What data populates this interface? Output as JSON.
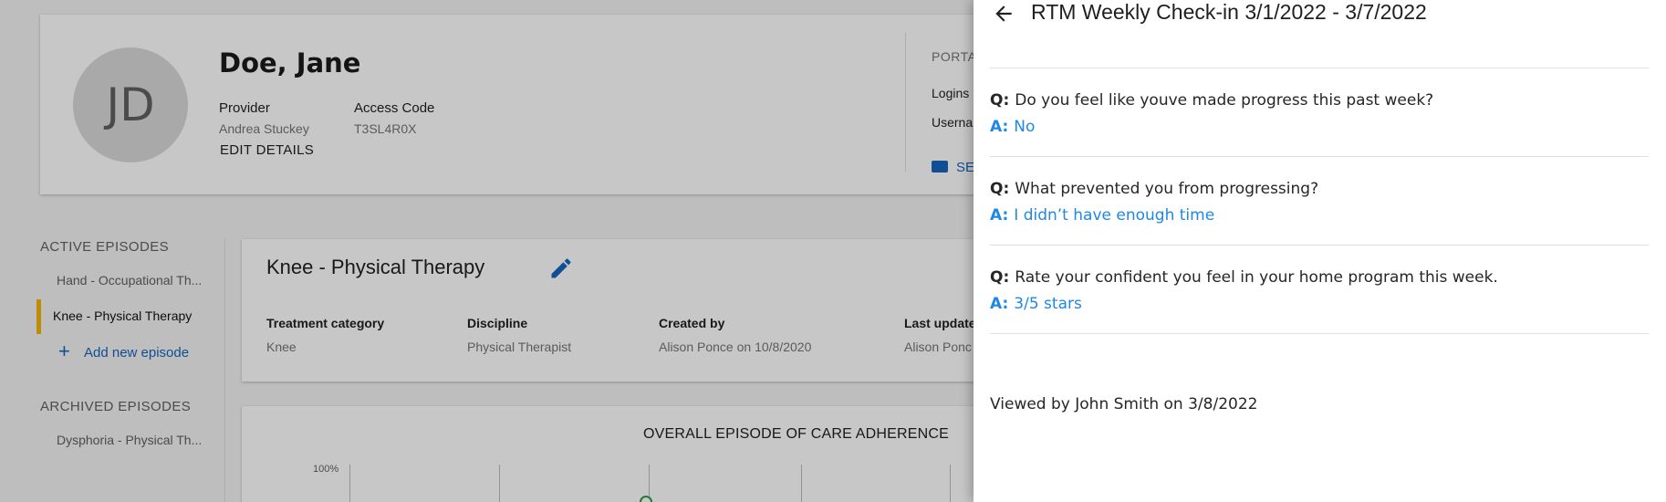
{
  "patient": {
    "initials": "JD",
    "name": "Doe, Jane",
    "provider_label": "Provider",
    "provider_value": "Andrea Stuckey",
    "access_code_label": "Access Code",
    "access_code_value": "T3SL4R0X",
    "edit_label": "EDIT DETAILS"
  },
  "portal": {
    "title": "PORTA",
    "logins": "Logins",
    "username": "Userna",
    "send_label": "SE"
  },
  "sidebar": {
    "active_heading": "ACTIVE EPISODES",
    "active_items": [
      {
        "label": "Hand  - Occupational Th..."
      },
      {
        "label": "Knee - Physical Therapy"
      }
    ],
    "add_label": "Add new episode",
    "archived_heading": "ARCHIVED EPISODES",
    "archived_items": [
      {
        "label": "Dysphoria - Physical Th..."
      }
    ]
  },
  "episode": {
    "title": "Knee - Physical Therapy",
    "columns": [
      {
        "label": "Treatment category",
        "value": "Knee"
      },
      {
        "label": "Discipline",
        "value": "Physical Therapist"
      },
      {
        "label": "Created by",
        "value": "Alison Ponce on 10/8/2020"
      },
      {
        "label": "Last update",
        "value": "Alison Ponc"
      }
    ]
  },
  "adherence": {
    "title": "OVERALL EPISODE OF CARE ADHERENCE",
    "y_tick": "100%"
  },
  "drawer": {
    "title": "RTM Weekly Check-in 3/1/2022 - 3/7/2022",
    "q_prefix": "Q:",
    "a_prefix": "A:",
    "qa": [
      {
        "question": "Do you feel like youve made progress this past week?",
        "answer": "No"
      },
      {
        "question": "What prevented you from progressing?",
        "answer": "I didn’t have enough time"
      },
      {
        "question": "Rate your confident you feel in your home program this week.",
        "answer": "3/5 stars"
      }
    ],
    "viewed_by": "Viewed by John Smith on 3/8/2022"
  },
  "colors": {
    "accent_blue": "#1565c0",
    "answer_blue": "#1e88e5",
    "active_marker": "#f2b705",
    "chart_marker": "#2e9b4f"
  }
}
